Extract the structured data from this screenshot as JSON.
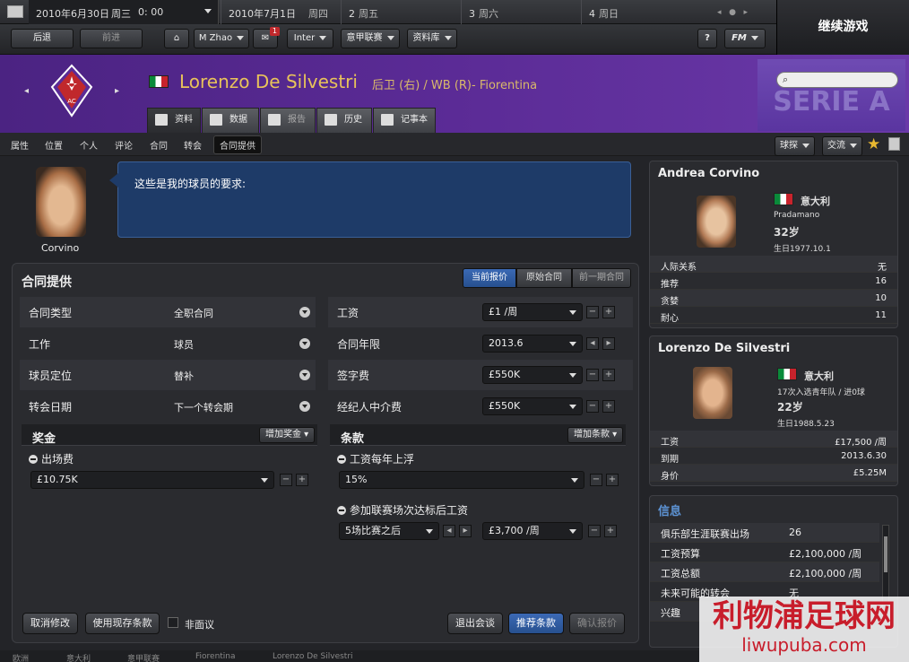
{
  "datebar": {
    "current_date": "2010年6月30日",
    "current_weekday": "周三",
    "current_time": "0: 00",
    "days": [
      {
        "date": "2010年7月1日",
        "weekday": "周四"
      },
      {
        "date": "2",
        "weekday": "周五"
      },
      {
        "date": "3",
        "weekday": "周六"
      },
      {
        "date": "4",
        "weekday": "周日"
      }
    ]
  },
  "nav": {
    "back": "后退",
    "forward": "前进",
    "manager": "M Zhao",
    "inbox_count": "1",
    "club": "Inter",
    "league": "意甲联赛",
    "database": "资料库",
    "help": "?",
    "fm": "FM",
    "continue": "继续游戏"
  },
  "player": {
    "name": "Lorenzo De Silvestri",
    "desc": "后卫 (右) / WB (R)- Fiorentina",
    "crest_text": "AC"
  },
  "serie": "SERIE A",
  "tabs": [
    "资料",
    "数据",
    "报告",
    "历史",
    "记事本"
  ],
  "subnav": [
    "属性",
    "位置",
    "个人",
    "评论",
    "合同",
    "转会",
    "合同提供"
  ],
  "right_buttons": {
    "scout": "球探",
    "interact": "交流"
  },
  "agent": {
    "name": "Corvino",
    "speech": "这些是我的球员的要求:"
  },
  "contract": {
    "title": "合同提供",
    "segments": [
      "当前报价",
      "原始合同",
      "前一期合同"
    ],
    "left_rows": [
      {
        "label": "合同类型",
        "value": "全职合同"
      },
      {
        "label": "工作",
        "value": "球员"
      },
      {
        "label": "球员定位",
        "value": "替补"
      },
      {
        "label": "转会日期",
        "value": "下一个转会期"
      }
    ],
    "right_rows": [
      {
        "label": "工资",
        "value": "£1 /周"
      },
      {
        "label": "合同年限",
        "value": "2013.6"
      },
      {
        "label": "签字费",
        "value": "£550K"
      },
      {
        "label": "经纪人中介费",
        "value": "£550K"
      }
    ],
    "bonus": {
      "title": "奖金",
      "add": "增加奖金",
      "item": "出场费",
      "value": "£10.75K"
    },
    "clauses": {
      "title": "条款",
      "add": "增加条款",
      "item1": "工资每年上浮",
      "value1": "15%",
      "item2": "参加联赛场次达标后工资",
      "value2a": "5场比赛之后",
      "value2b": "£3,700 /周"
    },
    "buttons": {
      "cancel": "取消修改",
      "use_current": "使用现存条款",
      "non_negotiable": "非面议",
      "exit": "退出会谈",
      "suggest": "推荐条款",
      "confirm": "确认报价"
    }
  },
  "agent_card": {
    "name": "Andrea Corvino",
    "nation": "意大利",
    "club": "Pradamano",
    "age": "32岁",
    "birth": "生日1977.10.1",
    "rows": [
      {
        "k": "人际关系",
        "v": "无"
      },
      {
        "k": "推荐",
        "v": "16"
      },
      {
        "k": "贪婪",
        "v": "10"
      },
      {
        "k": "耐心",
        "v": "11"
      }
    ]
  },
  "player_card": {
    "name": "Lorenzo De Silvestri",
    "nation": "意大利",
    "caps": "17次入选青年队 / 进0球",
    "age": "22岁",
    "birth": "生日1988.5.23",
    "rows": [
      {
        "k": "工资",
        "v": "£17,500 /周"
      },
      {
        "k": "到期",
        "v": "2013.6.30"
      },
      {
        "k": "身价",
        "v": "£5.25M"
      }
    ]
  },
  "info": {
    "title": "信息",
    "rows": [
      {
        "k": "俱乐部生涯联赛出场",
        "v": "26"
      },
      {
        "k": "工资预算",
        "v": "£2,100,000 /周"
      },
      {
        "k": "工资总额",
        "v": "£2,100,000 /周"
      },
      {
        "k": "未来可能的转会",
        "v": "无"
      },
      {
        "k": "兴趣",
        "v": ""
      }
    ]
  },
  "footer": [
    "欧洲",
    "意大利",
    "意甲联赛",
    "Fiorentina",
    "Lorenzo De Silvestri"
  ],
  "watermark": {
    "cn": "利物浦足球网",
    "url": "liwupuba.com"
  },
  "colors": {
    "header": "#5b2b96",
    "name": "#e8c35a",
    "accent": "#3b69b5"
  }
}
